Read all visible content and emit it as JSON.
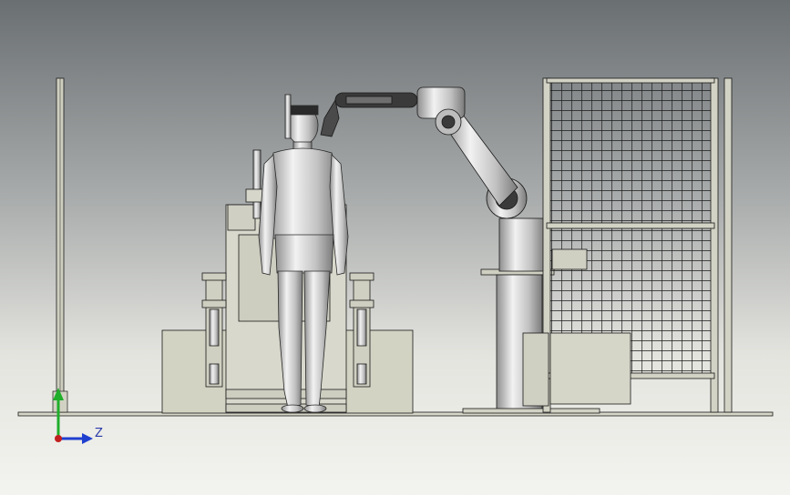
{
  "viewport": {
    "title": ""
  },
  "triad": {
    "z_label": "Z",
    "x_color": "#c22020",
    "y_color": "#1fae2a",
    "z_color": "#1f3fcf"
  },
  "scene": {
    "objects": [
      "ground-floor",
      "left-post",
      "workbench",
      "jig-fixture",
      "human-mannequin",
      "robot-arm",
      "robot-pedestal",
      "safety-fence",
      "control-cabinet"
    ],
    "fill_color": "#d3d3c3",
    "line_color": "#1a1a1a",
    "metal_color": "#c7c7c7"
  }
}
